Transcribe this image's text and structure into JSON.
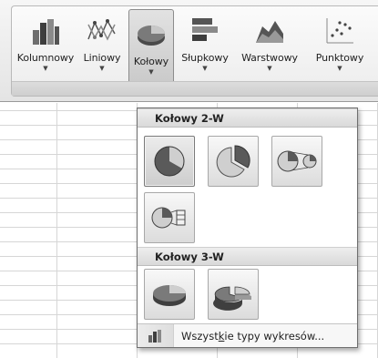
{
  "ribbon": {
    "buttons": [
      {
        "label": "Kolumnowy",
        "icon": "column-chart-icon"
      },
      {
        "label": "Liniowy",
        "icon": "line-chart-icon"
      },
      {
        "label": "Kołowy",
        "icon": "pie-chart-icon",
        "active": true
      },
      {
        "label": "Słupkowy",
        "icon": "bar-chart-icon"
      },
      {
        "label": "Warstwowy",
        "icon": "area-chart-icon"
      },
      {
        "label": "Punktowy",
        "icon": "scatter-chart-icon"
      }
    ]
  },
  "dropdown": {
    "section_2d": {
      "title": "Kołowy 2-W",
      "items": [
        "pie-2d-icon",
        "exploded-pie-2d-icon",
        "pie-of-pie-2d-icon",
        "bar-of-pie-2d-icon"
      ]
    },
    "section_3d": {
      "title": "Kołowy 3-W",
      "items": [
        "pie-3d-icon",
        "exploded-pie-3d-icon"
      ]
    },
    "footer": {
      "label_before": "Wszyst",
      "label_mnemonic": "k",
      "label_after": "ie typy wykresów...",
      "icon": "all-chart-types-icon"
    }
  },
  "colors": {
    "pie_dark": "#5a5a5a",
    "pie_light": "#cfcfcf"
  }
}
